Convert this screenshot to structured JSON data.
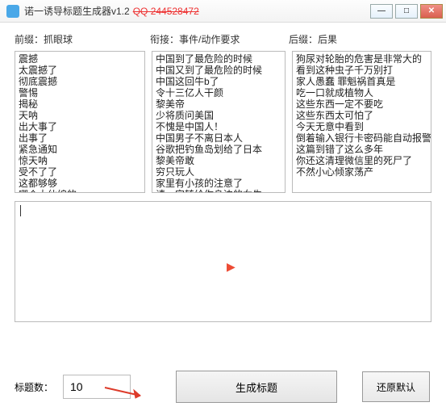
{
  "window": {
    "title": "诺一诱导标题生成器v1.2",
    "qq": "QQ 244528472"
  },
  "labels": {
    "prefix": "前缀：抓眼球",
    "bridge": "衔接：事件/动作要求",
    "suffix": "后缀：后果"
  },
  "lists": {
    "prefix": "震撼\n太震撼了\n彻底震撼\n警惕\n揭秘\n天呐\n出大事了\n出事了\n紧急通知\n惊天呐\n受不了了\n这都够够\n哪个大仙编的",
    "bridge": "中国到了最危险的时候\n中国又到了最危险的时候\n中国这回牛b了\n令十三亿人干颜\n黎美帝\n少将质问美国\n不愧是中国人！\n中国男子不离日本人\n谷歌把钓鱼岛划给了日本\n黎美帝敢\n穷只玩人\n家里有小孩的注意了\n请一定转给你身边的女生",
    "suffix": "狗尿对轮胎的危害是非常大的\n看到这种虫子千万别打\n家人愚蠢 罪魁祸首真是\n吃一口就成植物人\n这些东西一定不要吃\n这些东西太可怕了\n今天无意中看到\n倒着输入银行卡密码能自动报警\n这篇到错了这么多年\n你还这清理微信里的死尸了\n不然小心倾家荡产"
  },
  "output": {
    "value": ""
  },
  "bottom": {
    "count_label": "标题数：",
    "count_value": "10",
    "generate": "生成标题",
    "restore": "还原默认"
  }
}
